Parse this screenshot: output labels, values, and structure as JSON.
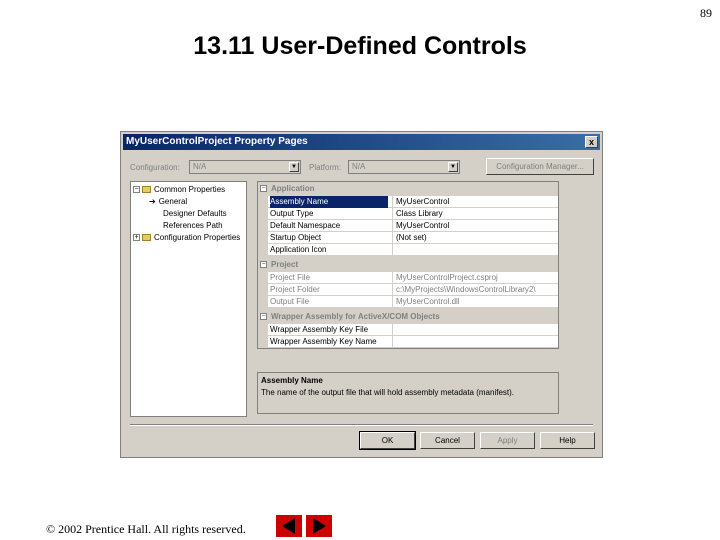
{
  "page_number": "89",
  "slide_title": "13.11  User-Defined Controls",
  "dialog": {
    "title": "MyUserControlProject Property Pages",
    "close_label": "x",
    "configuration_label": "Configuration:",
    "configuration_value": "N/A",
    "platform_label": "Platform:",
    "platform_value": "N/A",
    "config_manager_label": "Configuration Manager...",
    "tree": {
      "common_properties": "Common Properties",
      "items": [
        "General",
        "Designer Defaults",
        "References Path"
      ],
      "configuration_properties": "Configuration Properties"
    },
    "categories": {
      "application": "Application",
      "project": "Project",
      "wrapper": "Wrapper Assembly for ActiveX/COM Objects"
    },
    "application_rows": [
      {
        "name": "Assembly Name",
        "value": "MyUserControl"
      },
      {
        "name": "Output Type",
        "value": "Class Library"
      },
      {
        "name": "Default Namespace",
        "value": "MyUserControl"
      },
      {
        "name": "Startup Object",
        "value": "(Not set)"
      },
      {
        "name": "Application Icon",
        "value": ""
      }
    ],
    "project_rows": [
      {
        "name": "Project File",
        "value": "MyUserControlProject.csproj"
      },
      {
        "name": "Project Folder",
        "value": "c:\\MyProjects\\WindowsControlLibrary2\\"
      },
      {
        "name": "Output File",
        "value": "MyUserControl.dll"
      }
    ],
    "wrapper_rows": [
      {
        "name": "Wrapper Assembly Key File",
        "value": ""
      },
      {
        "name": "Wrapper Assembly Key Name",
        "value": ""
      }
    ],
    "description_title": "Assembly Name",
    "description_text": "The name of the output file that will hold assembly metadata (manifest).",
    "buttons": {
      "ok": "OK",
      "cancel": "Cancel",
      "apply": "Apply",
      "help": "Help"
    }
  },
  "footer": "© 2002 Prentice Hall.  All rights reserved.",
  "colors": {
    "title_bar": "#0a246a",
    "dialog_bg": "#d4d0c8",
    "nav_button": "#cc0000"
  }
}
